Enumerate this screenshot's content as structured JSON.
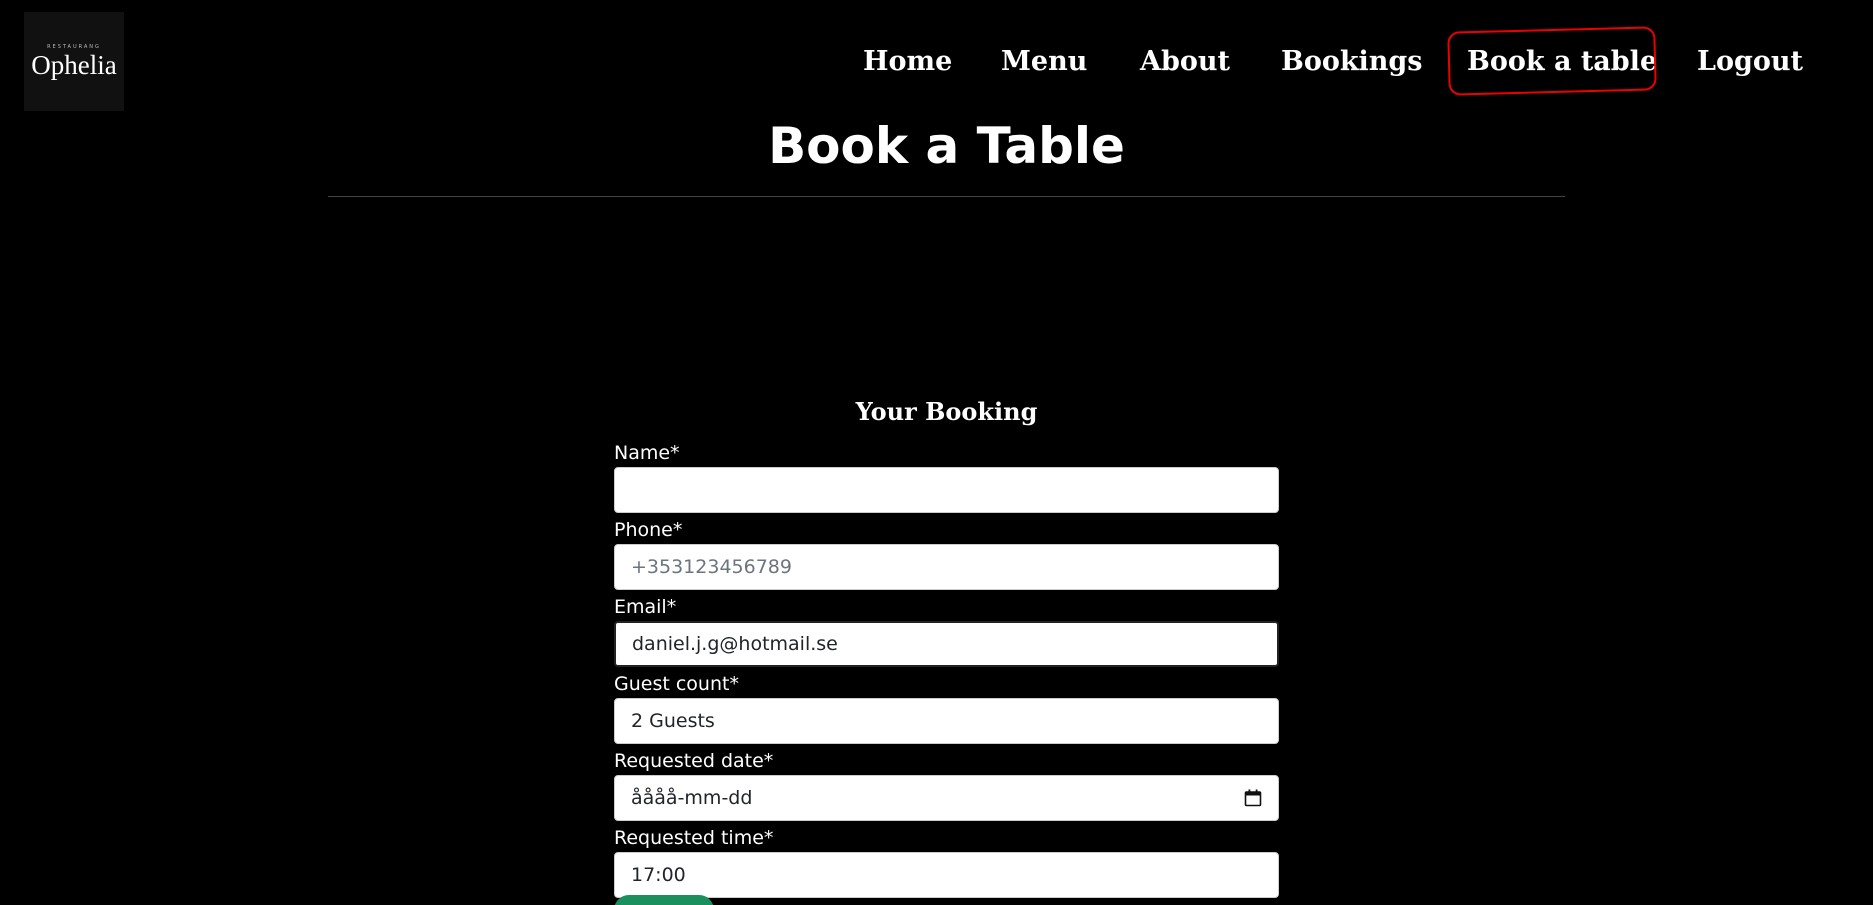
{
  "logo": {
    "subtitle": "RESTAURANG",
    "name": "Ophelia"
  },
  "nav": {
    "home": "Home",
    "menu": "Menu",
    "about": "About",
    "bookings": "Bookings",
    "book_table": "Book a table",
    "logout": "Logout"
  },
  "page": {
    "title": "Book a Table"
  },
  "form": {
    "heading": "Your Booking",
    "name": {
      "label": "Name*",
      "value": ""
    },
    "phone": {
      "label": "Phone*",
      "placeholder": "+353123456789"
    },
    "email": {
      "label": "Email*",
      "value": "daniel.j.g@hotmail.se"
    },
    "guests": {
      "label": "Guest count*",
      "value": "2 Guests"
    },
    "date": {
      "label": "Requested date*",
      "value": "åååå-mm-dd",
      "icon": "calendar-icon"
    },
    "time": {
      "label": "Requested time*",
      "value": "17:00"
    }
  },
  "colors": {
    "background": "#000000",
    "annotation": "#e00000",
    "submit": "#1c8f5e"
  }
}
